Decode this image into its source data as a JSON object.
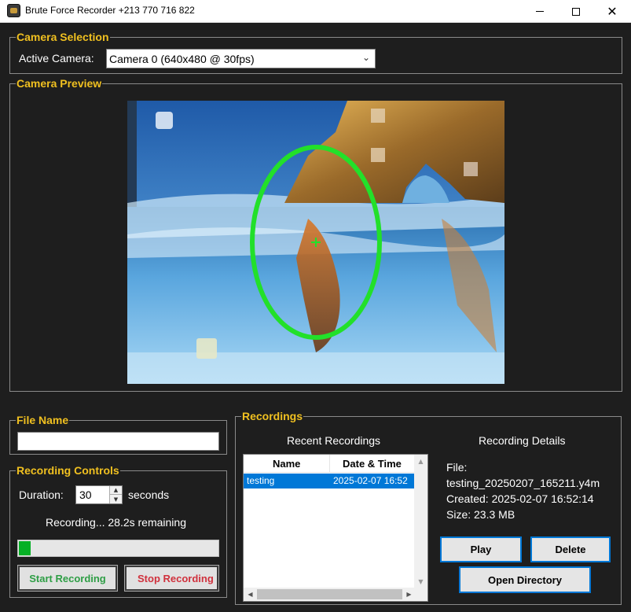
{
  "window": {
    "title": "Brute Force Recorder +213 770 716 822",
    "minimize_icon": "minimize-icon",
    "maximize_icon": "maximize-icon",
    "close_icon": "close-icon"
  },
  "camera_selection": {
    "title": "Camera Selection",
    "label": "Active Camera:",
    "selected": "Camera 0 (640x480 @ 30fps)"
  },
  "camera_preview": {
    "title": "Camera Preview",
    "overlay_color": "#22e02a"
  },
  "file_name": {
    "title": "File Name",
    "value": ""
  },
  "recording_controls": {
    "title": "Recording Controls",
    "duration_label": "Duration:",
    "duration_value": "30",
    "seconds_label": "seconds",
    "status": "Recording... 28.2s remaining",
    "progress": 0.06,
    "start_label": "Start Recording",
    "stop_label": "Stop Recording"
  },
  "recordings": {
    "title": "Recordings",
    "recent_title": "Recent Recordings",
    "columns": [
      "Name",
      "Date & Time"
    ],
    "rows": [
      {
        "name": "testing",
        "datetime": "2025-02-07 16:52"
      }
    ],
    "details_title": "Recording Details",
    "file_label": "File:",
    "file_value": "testing_20250207_165211.y4m",
    "created": "Created: 2025-02-07 16:52:14",
    "size": "Size: 23.3 MB",
    "play_label": "Play",
    "delete_label": "Delete",
    "open_dir_label": "Open Directory"
  },
  "colors": {
    "accent_title": "#f0c020",
    "selection": "#0078d7",
    "progress_fill": "#06b025",
    "start_text": "#2e9e45",
    "stop_text": "#d0313d"
  }
}
